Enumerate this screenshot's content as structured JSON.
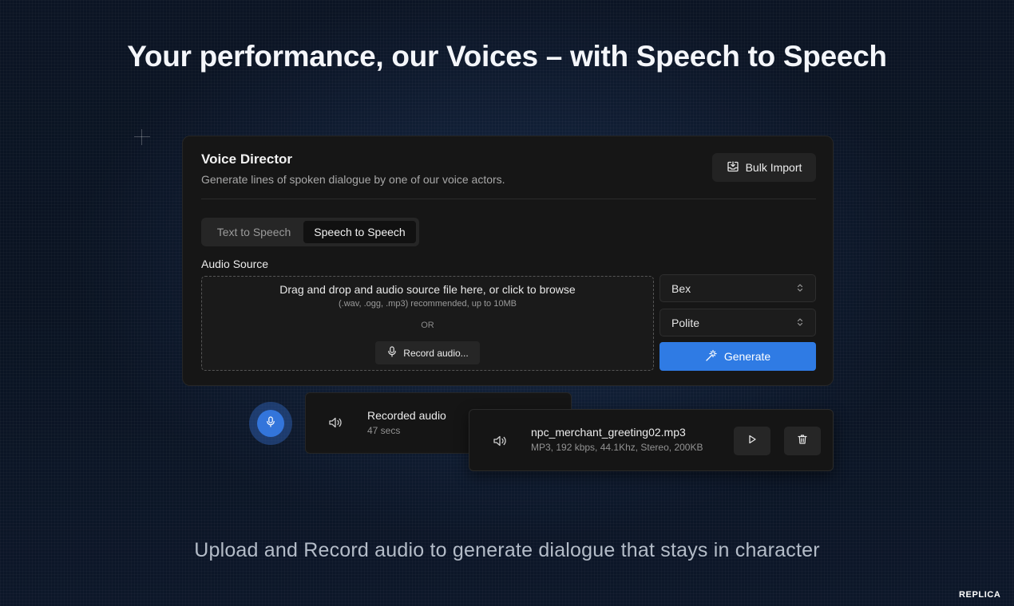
{
  "hero": {
    "title": "Your performance, our Voices – with Speech to Speech",
    "subtitle": "Upload and Record audio to generate dialogue that stays in character"
  },
  "card": {
    "title": "Voice Director",
    "description": "Generate lines of spoken dialogue by one of our voice actors.",
    "bulk_import_label": "Bulk Import",
    "tabs": [
      {
        "label": "Text to Speech",
        "active": false
      },
      {
        "label": "Speech to Speech",
        "active": true
      }
    ],
    "audio_source_label": "Audio Source",
    "dropzone": {
      "main": "Drag and drop and audio source file here, or click to browse",
      "hint": "(.wav, .ogg, .mp3) recommended, up to 10MB",
      "or": "OR",
      "record_label": "Record audio..."
    },
    "voice_select": "Bex",
    "style_select": "Polite",
    "generate_label": "Generate"
  },
  "recorded_audio": {
    "title": "Recorded audio",
    "duration": "47 secs"
  },
  "uploaded_file": {
    "name": "npc_merchant_greeting02.mp3",
    "meta": "MP3, 192 kbps, 44.1Khz, Stereo, 200KB"
  },
  "brand": "REPLICA",
  "colors": {
    "accent": "#2f7be4",
    "card_bg": "#161616",
    "page_bg": "#0b1424"
  }
}
